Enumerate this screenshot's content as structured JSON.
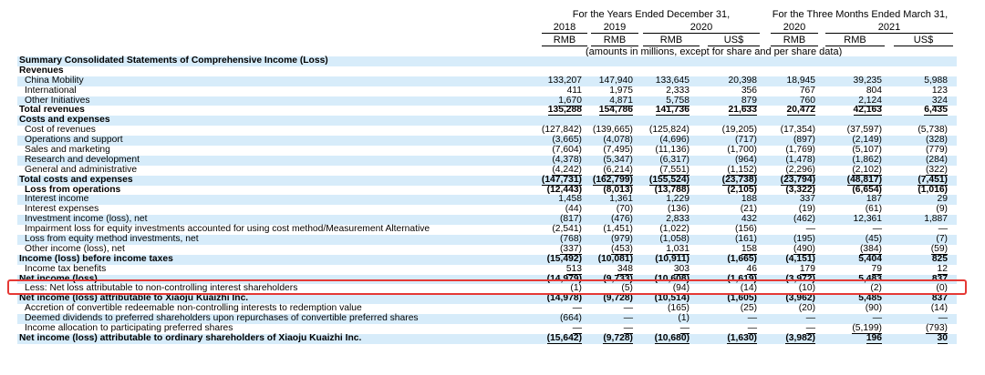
{
  "header": {
    "group_years": "For the Years Ended December 31,",
    "group_months": "For the Three Months Ended March 31,",
    "years": [
      "2018",
      "2019",
      "2020",
      "",
      "2020",
      "2021",
      ""
    ],
    "currencies": [
      "RMB",
      "RMB",
      "RMB",
      "US$",
      "RMB",
      "RMB",
      "US$"
    ],
    "units_note": "(amounts in millions, except for share and per share data)"
  },
  "rows": [
    {
      "label": "Summary Consolidated Statements of Comprehensive Income (Loss)",
      "bold": true,
      "indent": 0,
      "shade": true,
      "values": [
        "",
        "",
        "",
        "",
        "",
        "",
        ""
      ]
    },
    {
      "label": "Revenues",
      "bold": true,
      "indent": 0,
      "shade": false,
      "values": [
        "",
        "",
        "",
        "",
        "",
        "",
        ""
      ]
    },
    {
      "label": "China Mobility",
      "bold": false,
      "indent": 1,
      "shade": true,
      "values": [
        "133,207",
        "147,940",
        "133,645",
        "20,398",
        "18,945",
        "39,235",
        "5,988"
      ]
    },
    {
      "label": "International",
      "bold": false,
      "indent": 1,
      "shade": false,
      "values": [
        "411",
        "1,975",
        "2,333",
        "356",
        "767",
        "804",
        "123"
      ]
    },
    {
      "label": "Other Initiatives",
      "bold": false,
      "indent": 1,
      "shade": true,
      "ul": true,
      "values": [
        "1,670",
        "4,871",
        "5,758",
        "879",
        "760",
        "2,124",
        "324"
      ]
    },
    {
      "label": "Total revenues",
      "bold": true,
      "indent": 0,
      "shade": false,
      "ul": true,
      "values": [
        "135,288",
        "154,786",
        "141,736",
        "21,633",
        "20,472",
        "42,163",
        "6,435"
      ]
    },
    {
      "label": "Costs and expenses",
      "bold": true,
      "indent": 0,
      "shade": true,
      "values": [
        "",
        "",
        "",
        "",
        "",
        "",
        ""
      ]
    },
    {
      "label": "Cost of revenues",
      "bold": false,
      "indent": 1,
      "shade": false,
      "values": [
        "(127,842)",
        "(139,665)",
        "(125,824)",
        "(19,205)",
        "(17,354)",
        "(37,597)",
        "(5,738)"
      ]
    },
    {
      "label": "Operations and support",
      "bold": false,
      "indent": 1,
      "shade": true,
      "values": [
        "(3,665)",
        "(4,078)",
        "(4,696)",
        "(717)",
        "(897)",
        "(2,149)",
        "(328)"
      ]
    },
    {
      "label": "Sales and marketing",
      "bold": false,
      "indent": 1,
      "shade": false,
      "values": [
        "(7,604)",
        "(7,495)",
        "(11,136)",
        "(1,700)",
        "(1,769)",
        "(5,107)",
        "(779)"
      ]
    },
    {
      "label": "Research and development",
      "bold": false,
      "indent": 1,
      "shade": true,
      "values": [
        "(4,378)",
        "(5,347)",
        "(6,317)",
        "(964)",
        "(1,478)",
        "(1,862)",
        "(284)"
      ]
    },
    {
      "label": "General and administrative",
      "bold": false,
      "indent": 1,
      "shade": false,
      "ul": true,
      "values": [
        "(4,242)",
        "(6,214)",
        "(7,551)",
        "(1,152)",
        "(2,296)",
        "(2,102)",
        "(322)"
      ]
    },
    {
      "label": "Total costs and expenses",
      "bold": true,
      "indent": 0,
      "shade": true,
      "ul": true,
      "values": [
        "(147,731)",
        "(162,799)",
        "(155,524)",
        "(23,738)",
        "(23,794)",
        "(48,817)",
        "(7,451)"
      ]
    },
    {
      "label": "Loss from operations",
      "bold": true,
      "indent": 1,
      "shade": false,
      "values": [
        "(12,443)",
        "(8,013)",
        "(13,788)",
        "(2,105)",
        "(3,322)",
        "(6,654)",
        "(1,016)"
      ]
    },
    {
      "label": "Interest income",
      "bold": false,
      "indent": 1,
      "shade": true,
      "values": [
        "1,458",
        "1,361",
        "1,229",
        "188",
        "337",
        "187",
        "29"
      ]
    },
    {
      "label": "Interest expenses",
      "bold": false,
      "indent": 1,
      "shade": false,
      "values": [
        "(44)",
        "(70)",
        "(136)",
        "(21)",
        "(19)",
        "(61)",
        "(9)"
      ]
    },
    {
      "label": "Investment income (loss), net",
      "bold": false,
      "indent": 1,
      "shade": true,
      "values": [
        "(817)",
        "(476)",
        "2,833",
        "432",
        "(462)",
        "12,361",
        "1,887"
      ]
    },
    {
      "label": "Impairment loss for equity investments accounted for using cost method/Measurement Alternative",
      "bold": false,
      "indent": 1,
      "shade": false,
      "values": [
        "(2,541)",
        "(1,451)",
        "(1,022)",
        "(156)",
        "—",
        "—",
        "—"
      ]
    },
    {
      "label": "Loss from equity method investments, net",
      "bold": false,
      "indent": 1,
      "shade": true,
      "values": [
        "(768)",
        "(979)",
        "(1,058)",
        "(161)",
        "(195)",
        "(45)",
        "(7)"
      ]
    },
    {
      "label": "Other income (loss), net",
      "bold": false,
      "indent": 1,
      "shade": false,
      "ul": true,
      "values": [
        "(337)",
        "(453)",
        "1,031",
        "158",
        "(490)",
        "(384)",
        "(59)"
      ]
    },
    {
      "label": "Income (loss) before income taxes",
      "bold": true,
      "indent": 0,
      "shade": true,
      "values": [
        "(15,492)",
        "(10,081)",
        "(10,911)",
        "(1,665)",
        "(4,151)",
        "5,404",
        "825"
      ]
    },
    {
      "label": "Income tax benefits",
      "bold": false,
      "indent": 1,
      "shade": false,
      "ul": true,
      "values": [
        "513",
        "348",
        "303",
        "46",
        "179",
        "79",
        "12"
      ]
    },
    {
      "label": "Net income (loss)",
      "bold": true,
      "indent": 0,
      "shade": true,
      "values": [
        "(14,979)",
        "(9,733)",
        "(10,608)",
        "(1,619)",
        "(3,972)",
        "5,483",
        "837"
      ]
    },
    {
      "label": "Less: Net loss attributable to non-controlling interest shareholders",
      "bold": false,
      "indent": 1,
      "shade": false,
      "ul": true,
      "values": [
        "(1)",
        "(5)",
        "(94)",
        "(14)",
        "(10)",
        "(2)",
        "(0)"
      ]
    },
    {
      "label": "Net income (loss) attributable to Xiaoju Kuaizhi Inc.",
      "bold": true,
      "indent": 0,
      "shade": true,
      "values": [
        "(14,978)",
        "(9,728)",
        "(10,514)",
        "(1,605)",
        "(3,962)",
        "5,485",
        "837"
      ]
    },
    {
      "label": "Accretion of convertible redeemable non-controlling interests to redemption value",
      "bold": false,
      "indent": 1,
      "shade": false,
      "values": [
        "—",
        "—",
        "(165)",
        "(25)",
        "(20)",
        "(90)",
        "(14)"
      ]
    },
    {
      "label": "Deemed dividends to preferred shareholders upon repurchases of convertible preferred shares",
      "bold": false,
      "indent": 1,
      "shade": true,
      "values": [
        "(664)",
        "—",
        "(1)",
        "—",
        "—",
        "—",
        "—"
      ]
    },
    {
      "label": "Income allocation to participating preferred shares",
      "bold": false,
      "indent": 1,
      "shade": false,
      "ul": true,
      "values": [
        "—",
        "—",
        "—",
        "—",
        "—",
        "(5,199)",
        "(793)"
      ]
    },
    {
      "label": "Net income (loss) attributable to ordinary shareholders of Xiaoju Kuaizhi Inc.",
      "bold": true,
      "indent": 0,
      "shade": true,
      "ul": true,
      "values": [
        "(15,642)",
        "(9,728)",
        "(10,680)",
        "(1,630)",
        "(3,982)",
        "196",
        "30"
      ]
    }
  ],
  "colors": {
    "row_shade": "#d7ecfa",
    "highlight_border": "#e53935"
  }
}
